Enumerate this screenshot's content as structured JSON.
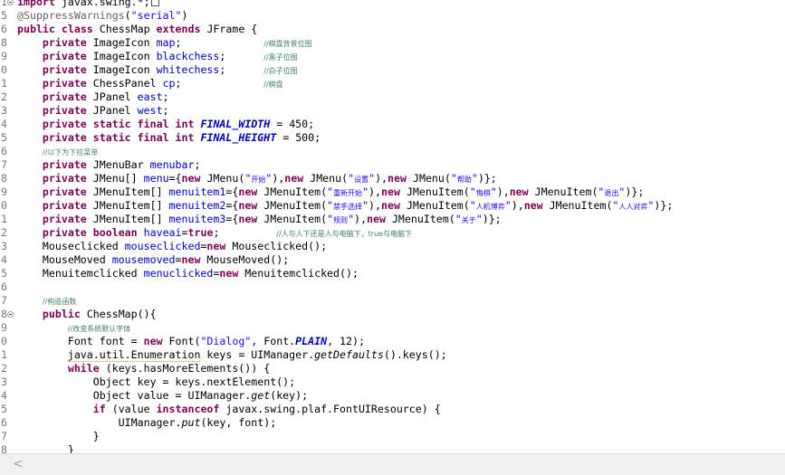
{
  "editor": {
    "lines": [
      {
        "n": "1",
        "html": "<span class=\"kw\">import</span> javax.swing.*;<span class=\"boxch\"></span>",
        "fold": true
      },
      {
        "n": "5",
        "html": "<span class=\"ann\">@SuppressWarnings</span>(<span class=\"str\">\"serial\"</span>)"
      },
      {
        "n": "6",
        "html": "<span class=\"kw\">public</span> <span class=\"kw\">class</span> ChessMap <span class=\"kw\">extends</span> JFrame {"
      },
      {
        "n": "8",
        "html": "    <span class=\"kw\">private</span> ImageIcon <span class=\"fld\">map</span>;             <span class=\"cmtsm\">//棋盘背景位图</span>"
      },
      {
        "n": "9",
        "html": "    <span class=\"kw\">private</span> ImageIcon <span class=\"fld\">blackchess</span>;      <span class=\"cmtsm\">//黑子位图</span>"
      },
      {
        "n": "0",
        "html": "    <span class=\"kw\">private</span> ImageIcon <span class=\"fld\">whitechess</span>;      <span class=\"cmtsm\">//白子位图</span>"
      },
      {
        "n": "1",
        "html": "    <span class=\"kw\">private</span> ChessPanel <span class=\"fld\">cp</span>;             <span class=\"cmtsm\">//棋盘</span>"
      },
      {
        "n": "2",
        "html": "    <span class=\"kw\">private</span> JPanel <span class=\"fld\">east</span>;"
      },
      {
        "n": "3",
        "html": "    <span class=\"kw\">private</span> JPanel <span class=\"fld\">west</span>;"
      },
      {
        "n": "4",
        "html": "    <span class=\"kw\">private</span> <span class=\"kw\">static</span> <span class=\"kw\">final</span> <span class=\"kw\">int</span> <span class=\"const\">FINAL_WIDTH</span> = 450;"
      },
      {
        "n": "5",
        "html": "    <span class=\"kw\">private</span> <span class=\"kw\">static</span> <span class=\"kw\">final</span> <span class=\"kw\">int</span> <span class=\"const\">FINAL_HEIGHT</span> = 500;"
      },
      {
        "n": "6",
        "html": "    <span class=\"cmtsm\">//以下为下拉菜单</span>"
      },
      {
        "n": "7",
        "html": "    <span class=\"kw\">private</span> JMenuBar <span class=\"fld\">menubar</span>;"
      },
      {
        "n": "8",
        "html": "    <span class=\"kw\">private</span> JMenu[] <span class=\"fld\">menu</span>={<span class=\"kw\">new</span> JMenu(<span class=\"str\">\"</span><span class=\"cmtsm\" style=\"color:#2a00ff\">开始</span><span class=\"str\">\"</span>),<span class=\"kw\">new</span> JMenu(<span class=\"str\">\"</span><span class=\"cmtsm\" style=\"color:#2a00ff\">设置</span><span class=\"str\">\"</span>),<span class=\"kw\">new</span> JMenu(<span class=\"str\">\"</span><span class=\"cmtsm\" style=\"color:#2a00ff\">帮助</span><span class=\"str\">\"</span>)};"
      },
      {
        "n": "9",
        "html": "    <span class=\"kw\">private</span> JMenuItem[] <span class=\"fld\">menuitem1</span>={<span class=\"kw\">new</span> JMenuItem(<span class=\"str\">\"</span><span class=\"cmtsm\" style=\"color:#2a00ff\">重新开始</span><span class=\"str\">\"</span>),<span class=\"kw\">new</span> JMenuItem(<span class=\"str\">\"</span><span class=\"cmtsm\" style=\"color:#2a00ff\">悔棋</span><span class=\"str\">\"</span>),<span class=\"kw\">new</span> JMenuItem(<span class=\"str\">\"</span><span class=\"cmtsm\" style=\"color:#2a00ff\">退出</span><span class=\"str\">\"</span>)};"
      },
      {
        "n": "0",
        "html": "    <span class=\"kw\">private</span> JMenuItem[] <span class=\"fld\">menuitem2</span>={<span class=\"kw\">new</span> JMenuItem(<span class=\"str\">\"</span><span class=\"cmtsm\" style=\"color:#2a00ff\">禁手选择</span><span class=\"str\">\"</span>),<span class=\"kw\">new</span> JMenuItem(<span class=\"str\">\"</span><span class=\"cmtsm\" style=\"color:#2a00ff\">人机博弈</span><span class=\"str\">\"</span>),<span class=\"kw\">new</span> JMenuItem(<span class=\"str\">\"</span><span class=\"cmtsm\" style=\"color:#2a00ff\">人人对弈</span><span class=\"str\">\"</span>)};"
      },
      {
        "n": "1",
        "html": "    <span class=\"kw\">private</span> JMenuItem[] <span class=\"fld\">menuitem3</span>={<span class=\"kw\">new</span> JMenuItem(<span class=\"str\">\"</span><span class=\"cmtsm\" style=\"color:#2a00ff\">规则</span><span class=\"str\">\"</span>),<span class=\"kw\">new</span> JMenuItem(<span class=\"str\">\"</span><span class=\"cmtsm\" style=\"color:#2a00ff\">关于</span><span class=\"str\">\"</span>)};"
      },
      {
        "n": "2",
        "html": "    <span class=\"kw\">private</span> <span class=\"kw\">boolean</span> <span class=\"fld\">haveai</span>=<span class=\"kw\">true</span>;         <span class=\"cmtsm\">//人与人下还是人与电脑下，true与电脑下</span>"
      },
      {
        "n": "3",
        "html": "    Mouseclicked <span class=\"fld\">mouseclicked</span>=<span class=\"kw\">new</span> Mouseclicked();"
      },
      {
        "n": "4",
        "html": "    MouseMoved <span class=\"fld\">mousemoved</span>=<span class=\"kw\">new</span> MouseMoved();"
      },
      {
        "n": "5",
        "html": "    Menuitemclicked <span class=\"fld\">menuclicked</span>=<span class=\"kw\">new</span> Menuitemclicked();"
      },
      {
        "n": "6",
        "html": ""
      },
      {
        "n": "7",
        "html": "    <span class=\"cmtsm\">//构造函数</span>"
      },
      {
        "n": "8",
        "html": "    <span class=\"kw\">public</span> ChessMap(){",
        "fold": true
      },
      {
        "n": "9",
        "html": "        <span class=\"cmtsm\">//改变系统默认字体</span>"
      },
      {
        "n": "0",
        "html": "        Font font = <span class=\"kw\">new</span> Font(<span class=\"str\">\"Dialog\"</span>, Font.<span class=\"const\">PLAIN</span>, 12);"
      },
      {
        "n": "1",
        "html": "        <span class=\"warn\">java.util.Enumeration</span> keys = UIManager.<span class=\"sta\">getDefaults</span>().keys();"
      },
      {
        "n": "2",
        "html": "        <span class=\"kw\">while</span> (keys.hasMoreElements()) {"
      },
      {
        "n": "3",
        "html": "            Object key = keys.nextElement();"
      },
      {
        "n": "4",
        "html": "            Object value = UIManager.<span class=\"sta\">get</span>(key);"
      },
      {
        "n": "5",
        "html": "            <span class=\"kw\">if</span> (value <span class=\"kw\">instanceof</span> javax.swing.plaf.FontUIResource) {"
      },
      {
        "n": "6",
        "html": "                UIManager.<span class=\"sta\">put</span>(key, font);"
      },
      {
        "n": "7",
        "html": "            }"
      },
      {
        "n": "8",
        "html": "        }"
      }
    ]
  },
  "scrollbar": {
    "left_arrow": "<"
  }
}
